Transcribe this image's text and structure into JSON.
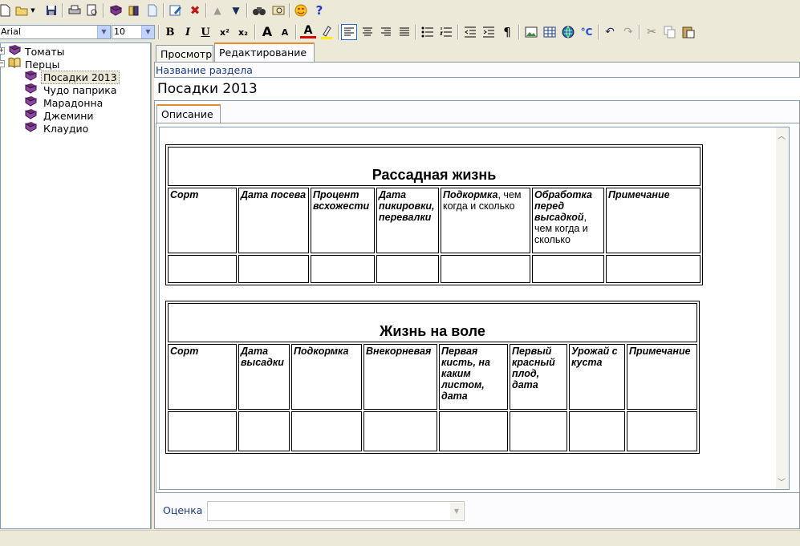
{
  "toolbar": {
    "row1": [
      "new-document-icon",
      "open-folder-icon",
      "save-icon",
      "print-icon",
      "print-preview-icon",
      "book-icon",
      "books-icon",
      "page-icon",
      "edit-pencil-icon",
      "delete-x-icon",
      "move-up-icon",
      "move-down-icon",
      "binoculars-icon",
      "image-search-icon",
      "smiley-mask-icon",
      "help-icon"
    ],
    "help_glyph": "?",
    "font_name": "Arial",
    "font_size": "10",
    "bold": "B",
    "italic": "I",
    "underline": "U",
    "superscript": "x²",
    "subscript": "x₂",
    "grow_font": "A",
    "shrink_font": "A",
    "text_color": "A",
    "pilcrow": "¶",
    "celsius": "°C"
  },
  "tree": {
    "items": [
      {
        "label": "Томаты",
        "level": 0,
        "type": "book"
      },
      {
        "label": "Перцы",
        "level": 0,
        "type": "open-book"
      },
      {
        "label": "Посадки 2013",
        "level": 1,
        "type": "book",
        "selected": true
      },
      {
        "label": "Чудо паприка",
        "level": 1,
        "type": "book"
      },
      {
        "label": "Марадонна",
        "level": 1,
        "type": "book"
      },
      {
        "label": "Джемини",
        "level": 1,
        "type": "book"
      },
      {
        "label": "Клаудио",
        "level": 1,
        "type": "book"
      }
    ]
  },
  "tabs": {
    "view": "Просмотр",
    "edit": "Редактирование"
  },
  "section": {
    "label": "Название раздела",
    "value": "Посадки 2013"
  },
  "subtab": "Описание",
  "table1": {
    "title": "Рассадная жизнь",
    "headers": [
      {
        "bold": "Сорт",
        "rest": ""
      },
      {
        "bold": "Дата посева",
        "rest": ""
      },
      {
        "bold": "Процент всхожести",
        "rest": ""
      },
      {
        "bold": "Дата пикировки, перевалки",
        "rest": ""
      },
      {
        "bold": "Подкормка",
        "rest": ", чем когда и сколько"
      },
      {
        "bold": "Обработка перед высадкой",
        "rest": ", чем когда и сколько"
      },
      {
        "bold": "Примечание",
        "rest": ""
      }
    ]
  },
  "table2": {
    "title": "Жизнь на воле",
    "headers": [
      "Сорт",
      "Дата высадки",
      "Подкормка",
      "Внекорневая",
      "Первая кисть, на каким листом, дата",
      "Первый красный плод, дата",
      "Урожай с куста",
      "Примечание"
    ]
  },
  "rating": {
    "label": "Оценка",
    "value": ""
  }
}
